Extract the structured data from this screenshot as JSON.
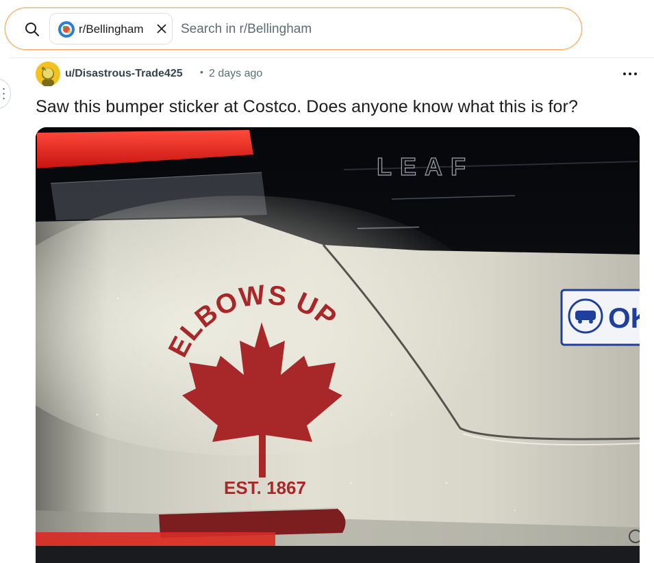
{
  "search": {
    "community_chip": "r/Bellingham",
    "placeholder": "Search in r/Bellingham",
    "value": ""
  },
  "post": {
    "author": "u/Disastrous-Trade425",
    "separator": "•",
    "time_ago": "2 days ago",
    "title": "Saw this bumper sticker at Costco. Does anyone know what this is for?"
  },
  "image": {
    "car_badge": "LEAF",
    "sticker_arc_text": "ELBOWS UP",
    "sticker_est_text": "EST. 1867",
    "plate_sticker_text": "OK"
  },
  "icons": {
    "search": "search-icon",
    "close": "close-icon",
    "more": "more-horizontal-icon",
    "community_avatar": "community-avatar-icon",
    "user_avatar": "user-avatar-icon"
  },
  "colors": {
    "search_border": "#f5a25d",
    "sticker_red": "#a8282a",
    "plate_blue": "#1f3f9c"
  }
}
